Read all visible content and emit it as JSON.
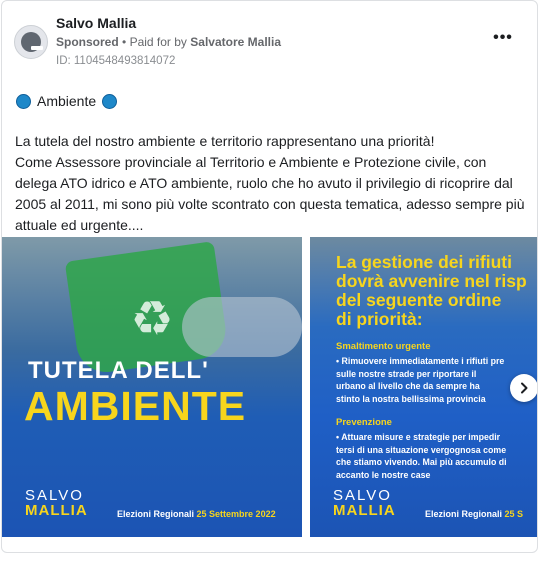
{
  "ad": {
    "page_name": "Salvo Mallia",
    "sponsored_label": "Sponsored",
    "paid_for_prefix": "Paid for by",
    "paid_for_name": "Salvatore Mallia",
    "ad_id": "ID: 1104548493814072",
    "more_icon": "more-horizontal-icon",
    "more_label": "•••"
  },
  "tag": {
    "text": "Ambiente",
    "dot_color": "#1e88c9"
  },
  "body": {
    "lines": [
      "La tutela del nostro ambiente e territorio rappresentano una priorità!",
      "Come Assessore provinciale al Territorio e Ambiente e Protezione civile, con",
      "delega ATO idrico e ATO ambiente, ruolo che ho avuto il privilegio di ricoprire dal",
      "2005 al 2011, mi sono più volte scontrato con questa tematica, adesso sempre più",
      "attuale ed urgente...."
    ]
  },
  "carousel": {
    "slide1": {
      "title_small": "TUTELA DELL'",
      "title_big": "AMBIENTE",
      "brand_first": "SALVO",
      "brand_last": "MALLIA",
      "footer_label": "Elezioni Regionali",
      "footer_date": "25 Settembre 2022",
      "recycle_icon": "♻"
    },
    "slide2": {
      "title_lines": [
        "La gestione dei rifiuti",
        "dovrà avvenire nel risp",
        "del seguente ordine",
        "di priorità:"
      ],
      "section1_heading": "Smaltimento urgente",
      "section1_lines": [
        "• Rimuovere immediatamente i rifiuti pre",
        "sulle nostre strade per riportare il",
        "urbano al livello che da sempre ha",
        "stinto la nostra bellissima provincia"
      ],
      "section2_heading": "Prevenzione",
      "section2_lines": [
        "• Attuare misure e strategie per impedir",
        "tersi di una situazione vergognosa come",
        "che stiamo vivendo. Mai più accumulo di",
        "accanto le nostre case"
      ],
      "brand_first": "SALVO",
      "brand_last": "MALLIA",
      "footer_label": "Elezioni Regionali",
      "footer_date": "25 S"
    },
    "next_icon": "chevron-right-icon"
  },
  "colors": {
    "accent_yellow": "#f7d51d",
    "brand_blue": "#1c54b4"
  }
}
